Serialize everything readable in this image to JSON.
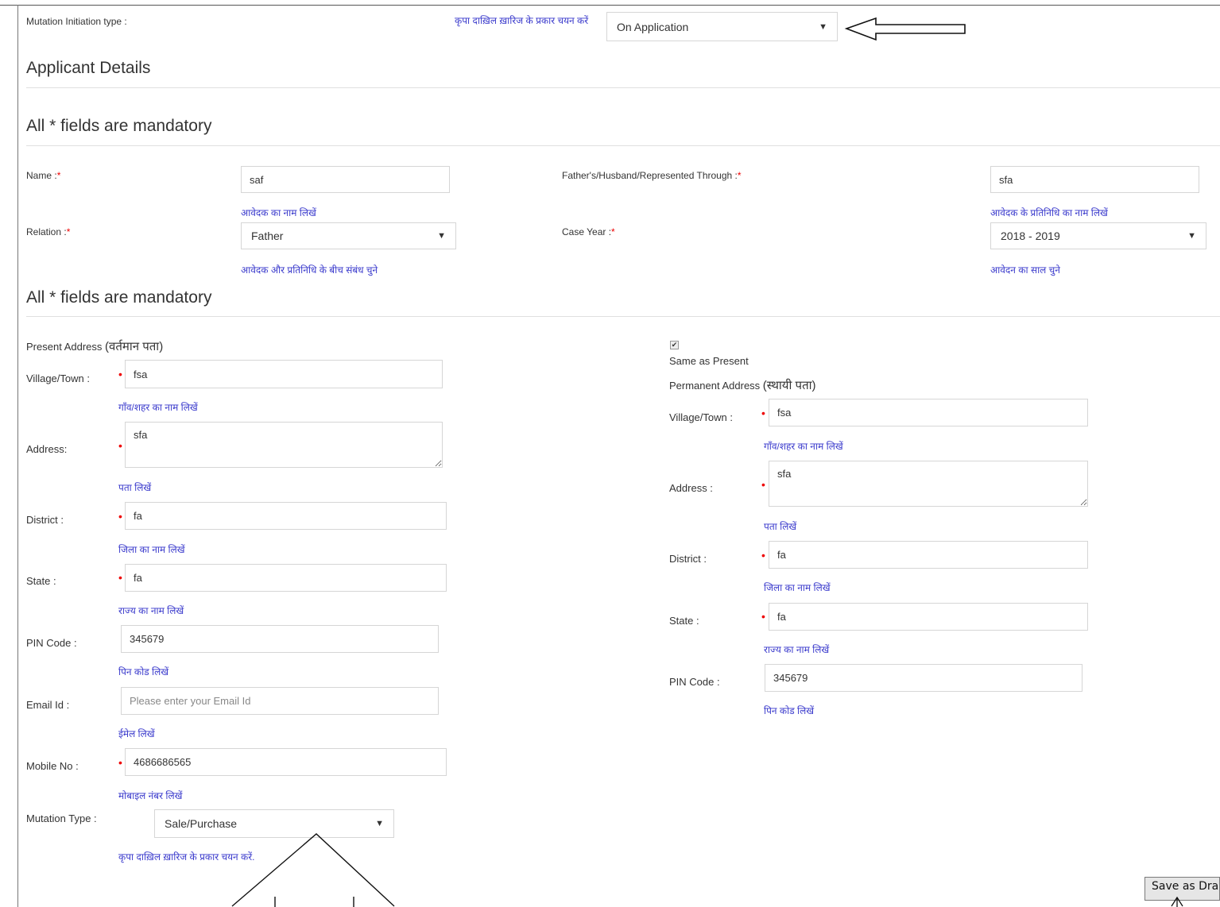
{
  "mutation_initiation": {
    "label": "Mutation Initiation type :",
    "hint": "कृपा दाख़िल ख़ारिज के प्रकार चयन करें",
    "selected": "On Application"
  },
  "applicant_heading": "Applicant Details",
  "mandatory_note": "All * fields are mandatory",
  "name": {
    "label": "Name :",
    "star": "*",
    "value": "saf",
    "hint": "आवेदक का नाम लिखें"
  },
  "father": {
    "label": "Father's/Husband/Represented Through :",
    "star": "*",
    "value": "sfa",
    "hint": "आवेदक के प्रतिनिधि का नाम लिखें"
  },
  "relation": {
    "label": "Relation :",
    "star": "*",
    "selected": "Father",
    "hint": "आवेदक और प्रतिनिधि के बीच संबंध चुने"
  },
  "case_year": {
    "label": "Case Year :",
    "star": "*",
    "selected": "2018 - 2019",
    "hint": "आवेदन का साल चुने"
  },
  "present": {
    "heading_en": "Present Address ",
    "heading_hi": "(वर्तमान पता)",
    "village": {
      "label": "Village/Town :",
      "value": "fsa",
      "hint": "गाँव/शहर का नाम लिखें"
    },
    "address": {
      "label": "Address:",
      "value": "sfa",
      "hint": "पता लिखें"
    },
    "district": {
      "label": "District :",
      "value": "fa",
      "hint": "जिला का नाम लिखें"
    },
    "state": {
      "label": "State :",
      "value": "fa",
      "hint": "राज्य का नाम लिखें"
    },
    "pin": {
      "label": "PIN Code :",
      "value": "345679",
      "hint": "पिन कोड लिखें"
    },
    "email": {
      "label": "Email Id :",
      "placeholder": "Please enter your Email Id",
      "hint": "ईमेल लिखें"
    },
    "mobile": {
      "label": "Mobile No :",
      "value": "4686686565",
      "hint": "मोबाइल नंबर लिखें"
    }
  },
  "same_as_present": {
    "label": "Same as Present",
    "checked": true,
    "check_glyph": "✔"
  },
  "permanent": {
    "heading_en": "Permanent Address ",
    "heading_hi": "(स्थायी पता)",
    "village": {
      "label": "Village/Town :",
      "value": "fsa",
      "hint": "गाँव/शहर का नाम लिखें"
    },
    "address": {
      "label": "Address :",
      "value": "sfa",
      "hint": "पता लिखें"
    },
    "district": {
      "label": "District :",
      "value": "fa",
      "hint": "जिला का नाम लिखें"
    },
    "state": {
      "label": "State :",
      "value": "fa",
      "hint": "राज्य का नाम लिखें"
    },
    "pin": {
      "label": "PIN Code :",
      "value": "345679",
      "hint": "पिन कोड लिखें"
    }
  },
  "mutation_type": {
    "label": "Mutation Type :",
    "selected": "Sale/Purchase",
    "hint": "कृपा दाख़िल ख़ारिज के प्रकार चयन करें."
  },
  "required_dot": "•",
  "caret": "▼",
  "save_draft_label": "Save as Dra"
}
